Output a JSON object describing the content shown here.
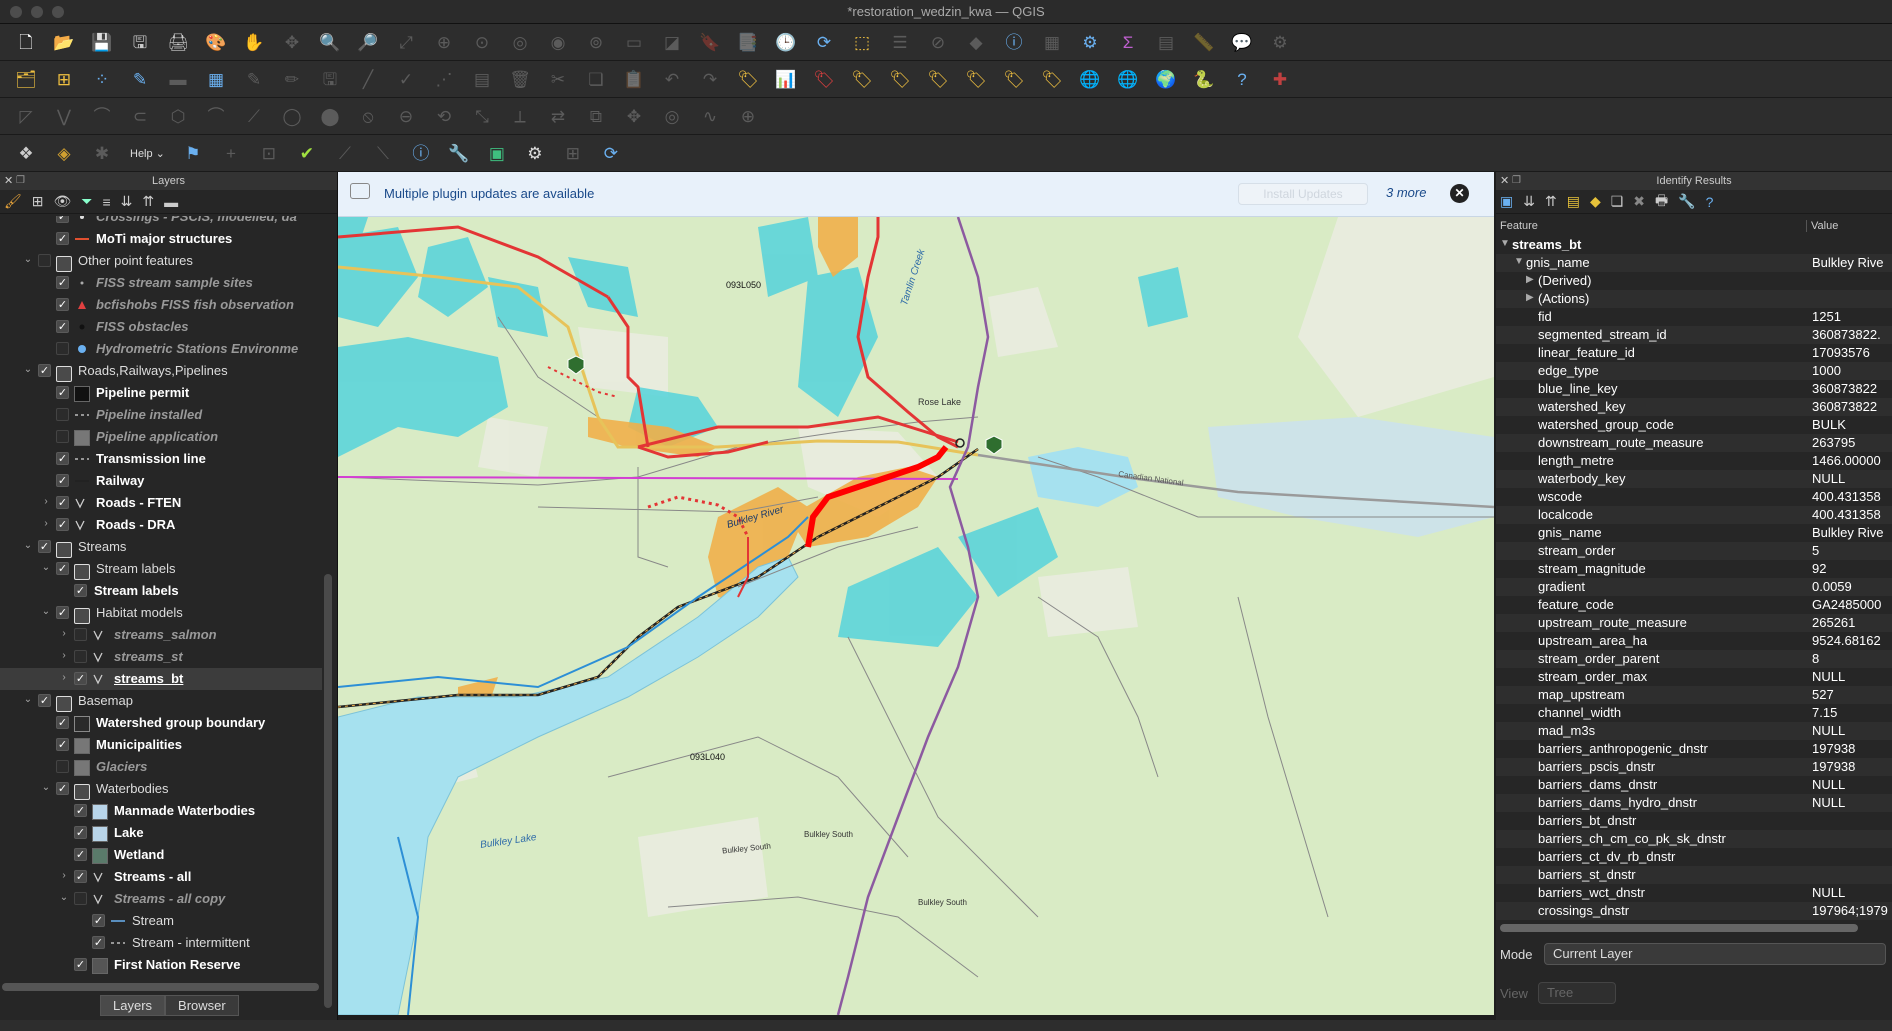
{
  "window": {
    "title": "*restoration_wedzin_kwa — QGIS"
  },
  "toolbars": {
    "row1": [
      "new-project-icon",
      "open-project-icon",
      "save-project-icon",
      "save-as-icon",
      "print-layout-icon",
      "style-manager-icon",
      "pan-hand-icon",
      "pan-selection-icon",
      "zoom-in-icon",
      "zoom-out-icon",
      "zoom-full-icon",
      "zoom-layer-icon",
      "zoom-selection-icon",
      "zoom-last-icon",
      "zoom-next-icon",
      "zoom-native-icon",
      "new-map-view-icon",
      "new-3d-view-icon",
      "bookmark-icon",
      "show-bookmarks-icon",
      "temporal-icon",
      "refresh-icon",
      "select-features-icon",
      "select-by-value-icon",
      "deselect-icon",
      "select-by-location-icon",
      "identify-icon",
      "attribute-table-icon",
      "processing-icon",
      "statistics-icon",
      "field-calculator-icon",
      "measure-icon",
      "tips-icon",
      "plugin-icon"
    ],
    "row2": [
      "data-source-manager-icon",
      "add-layer-icon",
      "new-layer-icon",
      "new-gpkg-icon",
      "new-shapefile-icon",
      "virtual-layer-icon",
      "edit-pencil-icon",
      "toggle-edit-icon",
      "save-edits-icon",
      "add-feature-icon",
      "vertex-tool-icon",
      "digitize-icon",
      "modify-icon",
      "delete-icon",
      "cut-icon",
      "copy-icon",
      "paste-icon",
      "undo-icon",
      "redo-icon",
      "label-icon",
      "diagram-icon",
      "highlight-label-icon",
      "pin-label-icon",
      "show-label-icon",
      "move-label-icon",
      "rotate-label-icon",
      "change-label-icon",
      "label-tool-icon",
      "globe-icon",
      "globe2-icon",
      "earth-icon",
      "python-icon",
      "help-icon",
      "crosshair-icon"
    ],
    "row3": [
      "digitize-shape-icon",
      "node-icon",
      "split-icon",
      "merge-icon",
      "reshape-icon",
      "offset-icon",
      "simplify-icon",
      "ring-icon",
      "fill-ring-icon",
      "delete-ring-icon",
      "delete-part-icon",
      "rotate-icon",
      "scale-icon",
      "trim-icon",
      "reverse-icon",
      "split-parts-icon",
      "move-icon",
      "buffer-icon",
      "curve-icon",
      "snap-icon"
    ],
    "row4": [
      "grass-icon",
      "plugin-a-icon",
      "plugin-b-icon",
      "help-menu",
      "flag-icon",
      "plus-icon",
      "georef-icon",
      "qgis2web-icon",
      "analysis-icon",
      "measure-line-icon",
      "info-icon",
      "wrench-icon",
      "rect-icon",
      "gear-icon",
      "add-box-icon",
      "refresh-icon"
    ],
    "help_label": "Help"
  },
  "layers": {
    "title": "Layers",
    "tabs": [
      "Layers",
      "Browser"
    ],
    "items": [
      {
        "name": "Crossings - PSCIS, modelled, da",
        "indent": 1,
        "cb": true,
        "style": "ital",
        "icon": "dot",
        "arrow": ""
      },
      {
        "name": "MoTi major structures",
        "indent": 1,
        "cb": true,
        "style": "bold",
        "icon": "line-red",
        "arrow": ""
      },
      {
        "name": "Other point features",
        "indent": 0,
        "cb": false,
        "style": "plain",
        "icon": "group",
        "arrow": "down"
      },
      {
        "name": "FISS stream sample sites",
        "indent": 1,
        "cb": true,
        "style": "ital",
        "icon": "dot-small",
        "arrow": ""
      },
      {
        "name": "bcfishobs FISS fish observation",
        "indent": 1,
        "cb": true,
        "style": "ital",
        "icon": "tri-red",
        "arrow": ""
      },
      {
        "name": "FISS obstacles",
        "indent": 1,
        "cb": true,
        "style": "ital",
        "icon": "dot-black",
        "arrow": ""
      },
      {
        "name": "Hydrometric Stations Environme",
        "indent": 1,
        "cb": false,
        "style": "ital",
        "icon": "dot-blue",
        "arrow": ""
      },
      {
        "name": "Roads,Railways,Pipelines",
        "indent": 0,
        "cb": true,
        "style": "plain",
        "icon": "group",
        "arrow": "down"
      },
      {
        "name": "Pipeline permit",
        "indent": 1,
        "cb": true,
        "style": "bold",
        "icon": "swatch-black",
        "arrow": ""
      },
      {
        "name": "Pipeline installed",
        "indent": 1,
        "cb": false,
        "style": "ital",
        "icon": "line-dash",
        "arrow": ""
      },
      {
        "name": "Pipeline application",
        "indent": 1,
        "cb": false,
        "style": "ital",
        "icon": "swatch-grey",
        "arrow": ""
      },
      {
        "name": "Transmission line",
        "indent": 1,
        "cb": true,
        "style": "bold",
        "icon": "line-dash",
        "arrow": ""
      },
      {
        "name": "Railway",
        "indent": 1,
        "cb": true,
        "style": "bold",
        "icon": "line-rail",
        "arrow": ""
      },
      {
        "name": "Roads - FTEN",
        "indent": 1,
        "cb": true,
        "style": "bold",
        "icon": "rule",
        "arrow": "right"
      },
      {
        "name": "Roads - DRA",
        "indent": 1,
        "cb": true,
        "style": "bold",
        "icon": "rule",
        "arrow": "right"
      },
      {
        "name": "Streams",
        "indent": 0,
        "cb": true,
        "style": "plain",
        "icon": "group",
        "arrow": "down"
      },
      {
        "name": "Stream labels",
        "indent": 1,
        "cb": true,
        "style": "plain",
        "icon": "group",
        "arrow": "down"
      },
      {
        "name": "Stream labels",
        "indent": 2,
        "cb": true,
        "style": "bold",
        "icon": "",
        "arrow": ""
      },
      {
        "name": "Habitat models",
        "indent": 1,
        "cb": true,
        "style": "plain",
        "icon": "group",
        "arrow": "down"
      },
      {
        "name": "streams_salmon",
        "indent": 2,
        "cb": false,
        "style": "ital",
        "icon": "rule",
        "arrow": "right"
      },
      {
        "name": "streams_st",
        "indent": 2,
        "cb": false,
        "style": "ital",
        "icon": "rule",
        "arrow": "right"
      },
      {
        "name": "streams_bt",
        "indent": 2,
        "cb": true,
        "style": "bold under",
        "icon": "rule",
        "arrow": "right",
        "selected": true
      },
      {
        "name": "Basemap",
        "indent": 0,
        "cb": true,
        "style": "plain",
        "icon": "group",
        "arrow": "down"
      },
      {
        "name": "Watershed group boundary",
        "indent": 1,
        "cb": true,
        "style": "bold",
        "icon": "swatch-outline",
        "arrow": ""
      },
      {
        "name": "Municipalities",
        "indent": 1,
        "cb": true,
        "style": "bold",
        "icon": "swatch-grey",
        "arrow": ""
      },
      {
        "name": "Glaciers",
        "indent": 1,
        "cb": false,
        "style": "ital",
        "icon": "swatch-grey",
        "arrow": ""
      },
      {
        "name": "Waterbodies",
        "indent": 1,
        "cb": true,
        "style": "plain",
        "icon": "group",
        "arrow": "down"
      },
      {
        "name": "Manmade Waterbodies",
        "indent": 2,
        "cb": true,
        "style": "bold",
        "icon": "swatch-lightblue",
        "arrow": ""
      },
      {
        "name": "Lake",
        "indent": 2,
        "cb": true,
        "style": "bold",
        "icon": "swatch-lightblue",
        "arrow": ""
      },
      {
        "name": "Wetland",
        "indent": 2,
        "cb": true,
        "style": "bold",
        "icon": "swatch-green",
        "arrow": ""
      },
      {
        "name": "Streams - all",
        "indent": 2,
        "cb": true,
        "style": "bold",
        "icon": "rule",
        "arrow": "right"
      },
      {
        "name": "Streams - all copy",
        "indent": 2,
        "cb": false,
        "style": "ital",
        "icon": "rule",
        "arrow": "down"
      },
      {
        "name": "Stream",
        "indent": 3,
        "cb": true,
        "style": "plain",
        "icon": "line-blue",
        "arrow": ""
      },
      {
        "name": "Stream - intermittent",
        "indent": 3,
        "cb": true,
        "style": "plain",
        "icon": "line-dash",
        "arrow": ""
      },
      {
        "name": "First Nation Reserve",
        "indent": 2,
        "cb": true,
        "style": "bold",
        "icon": "swatch-dark",
        "arrow": ""
      }
    ]
  },
  "notice": {
    "message": "Multiple plugin updates are available",
    "button": "Install Updates",
    "more": "3 more"
  },
  "map_labels": {
    "sheet1": "093L050",
    "sheet2": "093L040",
    "river": "Bulkley River",
    "lake": "Bulkley Lake",
    "creek": "Tamlin Creek",
    "south1": "Bulkley South",
    "south2": "Bulkley South",
    "south3": "Bulkley South",
    "rose": "Rose Lake",
    "rail": "Canadian National"
  },
  "identify": {
    "title": "Identify Results",
    "col_feature": "Feature",
    "col_value": "Value",
    "layer": "streams_bt",
    "root_key": "gnis_name",
    "root_value": "Bulkley Rive",
    "derived": "(Derived)",
    "actions": "(Actions)",
    "rows": [
      {
        "k": "fid",
        "v": "1251"
      },
      {
        "k": "segmented_stream_id",
        "v": "360873822."
      },
      {
        "k": "linear_feature_id",
        "v": "17093576"
      },
      {
        "k": "edge_type",
        "v": "1000"
      },
      {
        "k": "blue_line_key",
        "v": "360873822"
      },
      {
        "k": "watershed_key",
        "v": "360873822"
      },
      {
        "k": "watershed_group_code",
        "v": "BULK"
      },
      {
        "k": "downstream_route_measure",
        "v": "263795"
      },
      {
        "k": "length_metre",
        "v": "1466.00000"
      },
      {
        "k": "waterbody_key",
        "v": "NULL"
      },
      {
        "k": "wscode",
        "v": "400.431358"
      },
      {
        "k": "localcode",
        "v": "400.431358"
      },
      {
        "k": "gnis_name",
        "v": "Bulkley Rive"
      },
      {
        "k": "stream_order",
        "v": "5"
      },
      {
        "k": "stream_magnitude",
        "v": "92"
      },
      {
        "k": "gradient",
        "v": "0.0059"
      },
      {
        "k": "feature_code",
        "v": "GA2485000"
      },
      {
        "k": "upstream_route_measure",
        "v": "265261"
      },
      {
        "k": "upstream_area_ha",
        "v": "9524.68162"
      },
      {
        "k": "stream_order_parent",
        "v": "8"
      },
      {
        "k": "stream_order_max",
        "v": "NULL"
      },
      {
        "k": "map_upstream",
        "v": "527"
      },
      {
        "k": "channel_width",
        "v": "7.15"
      },
      {
        "k": "mad_m3s",
        "v": "NULL"
      },
      {
        "k": "barriers_anthropogenic_dnstr",
        "v": "197938"
      },
      {
        "k": "barriers_pscis_dnstr",
        "v": "197938"
      },
      {
        "k": "barriers_dams_dnstr",
        "v": "NULL"
      },
      {
        "k": "barriers_dams_hydro_dnstr",
        "v": "NULL"
      },
      {
        "k": "barriers_bt_dnstr",
        "v": ""
      },
      {
        "k": "barriers_ch_cm_co_pk_sk_dnstr",
        "v": ""
      },
      {
        "k": "barriers_ct_dv_rb_dnstr",
        "v": ""
      },
      {
        "k": "barriers_st_dnstr",
        "v": ""
      },
      {
        "k": "barriers_wct_dnstr",
        "v": "NULL"
      },
      {
        "k": "crossings_dnstr",
        "v": "197964;1979"
      }
    ],
    "mode_label": "Mode",
    "mode_value": "Current Layer",
    "view_label": "View",
    "view_value": "Tree"
  }
}
